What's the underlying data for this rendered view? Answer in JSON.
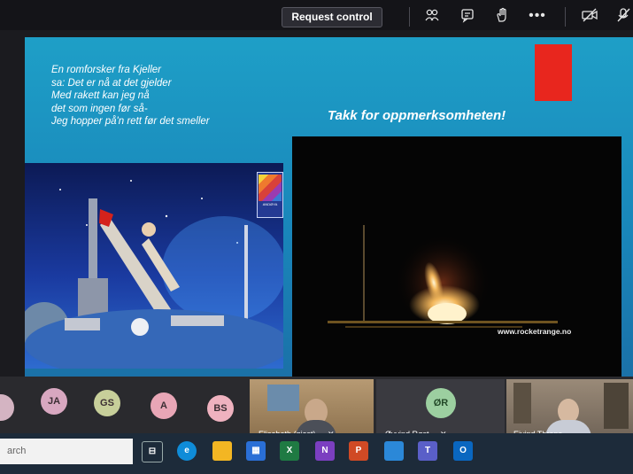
{
  "toolbar": {
    "request_control_label": "Request control",
    "icons": [
      "people-icon",
      "chat-icon",
      "raise-hand-icon",
      "more-icon",
      "camera-off-icon",
      "mic-off-icon"
    ]
  },
  "slide": {
    "poem_lines": [
      "En romforsker fra Kjeller",
      "sa: Det er nå at det gjelder",
      "Med rakett kan jeg nå",
      "det som ingen før så-",
      "Jeg hopper på'n rett før det smeller"
    ],
    "thanks_text": "Takk for oppmerksomheten!",
    "logo_text": "ANDØYA",
    "watermark": "www.rocketrange.no",
    "accent_red": "#e8261e"
  },
  "participants": {
    "avatars": [
      {
        "initials": "JA",
        "color": "#d8a7c0"
      },
      {
        "initials": "GS",
        "color": "#c7cf9a"
      },
      {
        "initials": "A",
        "color": "#e8a6b6"
      },
      {
        "initials": "BS",
        "color": "#efb2bf"
      }
    ],
    "tiles": [
      {
        "name": "Elisabeth (gjest)"
      },
      {
        "name": "Øyvind Røst",
        "initials": "ØR"
      },
      {
        "name": "Eivind Thrane"
      }
    ]
  },
  "taskbar": {
    "search_placeholder": "arch",
    "apps": [
      "task-view-icon",
      "edge-icon",
      "file-explorer-icon",
      "store-icon",
      "excel-icon",
      "onenote-icon",
      "powerpoint-icon",
      "photos-icon",
      "teams-icon",
      "outlook-icon"
    ],
    "app_labels": {
      "excel": "X",
      "onenote": "N",
      "powerpoint": "P",
      "outlook": "O"
    }
  }
}
